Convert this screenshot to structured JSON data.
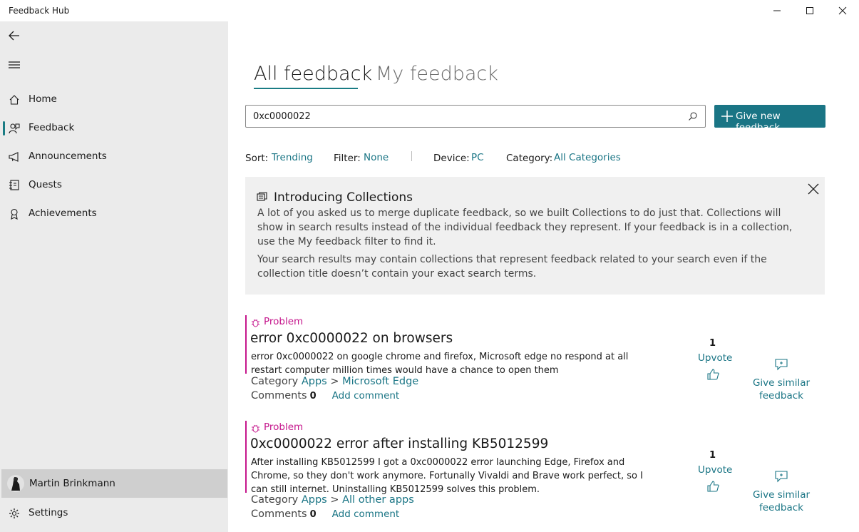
{
  "window": {
    "title": "Feedback Hub"
  },
  "sidebar": {
    "items": [
      {
        "label": "Home",
        "icon": "home-icon"
      },
      {
        "label": "Feedback",
        "icon": "feedback-icon",
        "selected": true
      },
      {
        "label": "Announcements",
        "icon": "megaphone-icon"
      },
      {
        "label": "Quests",
        "icon": "quests-icon"
      },
      {
        "label": "Achievements",
        "icon": "ribbon-icon"
      }
    ],
    "user": {
      "name": "Martin Brinkmann"
    },
    "settings_label": "Settings"
  },
  "tabs": {
    "all": "All feedback",
    "my": "My feedback",
    "active": "All feedback"
  },
  "search": {
    "value": "0xc0000022"
  },
  "new_feedback_label": "Give new feedback",
  "filters": {
    "sort_label": "Sort:",
    "sort_value": "Trending",
    "filter_label": "Filter:",
    "filter_value": "None",
    "device_label": "Device:",
    "device_value": "PC",
    "category_label": "Category:",
    "category_value": "All Categories"
  },
  "banner": {
    "title": "Introducing Collections",
    "p1": "A lot of you asked us to merge duplicate feedback, so we built Collections to do just that. Collections will show in search results instead of the individual feedback they represent. If your feedback is in a collection, use the My feedback filter to find it.",
    "p2": "Your search results may contain collections that represent feedback related to your search even if the collection title doesn’t contain your exact search terms."
  },
  "results": [
    {
      "kind": "Problem",
      "title": "error 0xc0000022 on browsers",
      "description": "error 0xc0000022 on google chrome and firefox, Microsoft edge no respond at all restart computer million times would have a chance to open them",
      "category_label": "Category",
      "category": "Apps",
      "subcategory": "Microsoft Edge",
      "comments_label": "Comments",
      "comments": "0",
      "add_comment": "Add comment",
      "votes": "1",
      "upvote_label": "Upvote",
      "similar_label": "Give similar feedback"
    },
    {
      "kind": "Problem",
      "title": "0xc0000022 error after installing KB5012599",
      "description": "After installing KB5012599 I got a 0xc0000022 error launching Edge, Firefox and Chrome, so they don't work anymore. Fortunally Vivaldi and Brave work perfect, so I can still internet. Uninstalling KB5012599 solves this problem.",
      "category_label": "Category",
      "category": "Apps",
      "subcategory": "All other apps",
      "comments_label": "Comments",
      "comments": "0",
      "add_comment": "Add comment",
      "votes": "1",
      "upvote_label": "Upvote",
      "similar_label": "Give similar feedback"
    }
  ],
  "colors": {
    "accent": "#1a7585",
    "problem": "#c5168c",
    "sidebar": "#ebebeb"
  }
}
